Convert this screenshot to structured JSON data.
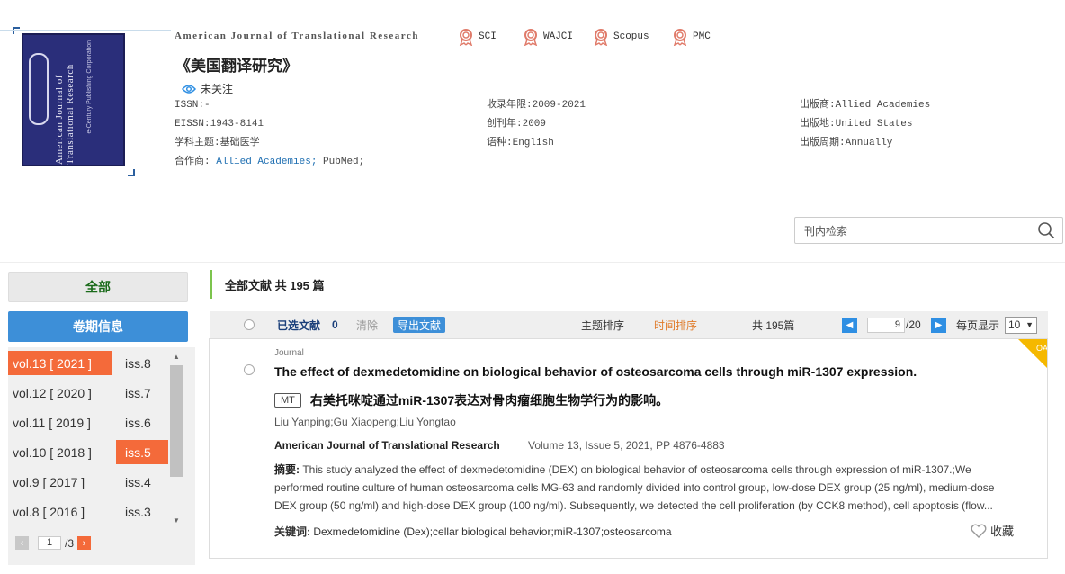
{
  "journal": {
    "name_en": "American Journal of Translational Research",
    "name_cn": "《美国翻译研究》",
    "follow_label": "未关注",
    "badges": [
      "SCI",
      "WAJCI",
      "Scopus",
      "PMC"
    ],
    "cover_text_main": "American Journal of Translational Research",
    "cover_text_sub": "e-Century Publishing Corporation"
  },
  "meta": {
    "issn": "ISSN:-",
    "eissn": "EISSN:1943-8141",
    "subject": "学科主题:基础医学",
    "partner_label": "合作商:",
    "partner_links": [
      "Allied Academies;",
      "PubMed;"
    ],
    "years": "收录年限:2009-2021",
    "founded": "创刊年:2009",
    "language": "语种:English",
    "publisher": "出版商:Allied Academies",
    "place": "出版地:United States",
    "cycle": "出版周期:Annually"
  },
  "search": {
    "placeholder": "刊内检索"
  },
  "sidebar": {
    "all_label": "全部",
    "volume_label": "卷期信息",
    "volumes": [
      "vol.13 [ 2021 ]",
      "vol.12 [ 2020 ]",
      "vol.11 [ 2019 ]",
      "vol.10 [ 2018 ]",
      "vol.9 [ 2017 ]",
      "vol.8 [ 2016 ]"
    ],
    "issues": [
      "iss.8",
      "iss.7",
      "iss.6",
      "iss.5",
      "iss.4",
      "iss.3"
    ],
    "active_volume": 0,
    "active_issue": 3,
    "page_current": "1",
    "page_total": "/3"
  },
  "list": {
    "heading": "全部文献 共 195 篇",
    "selected_label": "已选文献",
    "selected_count": "0",
    "clear_label": "清除",
    "export_label": "导出文献",
    "sort_topic": "主题排序",
    "sort_time": "时间排序",
    "total": "共 195篇",
    "page_current": "9",
    "page_total": "/20",
    "per_page_label": "每页显示",
    "per_page_value": "10"
  },
  "article": {
    "type": "Journal",
    "title_en": "The effect of dexmedetomidine on biological behavior of osteosarcoma cells through miR-1307 expression.",
    "mt_label": "MT",
    "title_cn": "右美托咪啶通过miR-1307表达对骨肉瘤细胞生物学行为的影响。",
    "authors": "Liu Yanping;Gu Xiaopeng;Liu Yongtao",
    "source": "American Journal of Translational Research",
    "volume_info": "Volume 13, Issue 5, 2021, PP 4876-4883",
    "abstract_label": "摘要:",
    "abstract_line1": "This study analyzed the effect of dexmedetomidine (DEX) on biological behavior of osteosarcoma cells through expression of miR-1307.;We",
    "abstract_line2": "performed routine culture of human osteosarcoma cells MG-63 and randomly divided into control group, low-dose DEX group (25 ng/ml), medium-dose",
    "abstract_line3": "DEX group (50 ng/ml) and high-dose DEX group (100 ng/ml). Subsequently, we detected the cell proliferation (by CCK8 method), cell apoptosis (flow...",
    "keywords_label": "关键词:",
    "keywords": "Dexmedetomidine (Dex);cellar biological behavior;miR-1307;osteosarcoma",
    "fav_label": "收藏",
    "oa_label": "OA"
  },
  "colors": {
    "accent_blue": "#3d8fd8",
    "accent_orange": "#f46a3a",
    "green_bar": "#7cc44d",
    "oa_yellow": "#f5b800"
  }
}
